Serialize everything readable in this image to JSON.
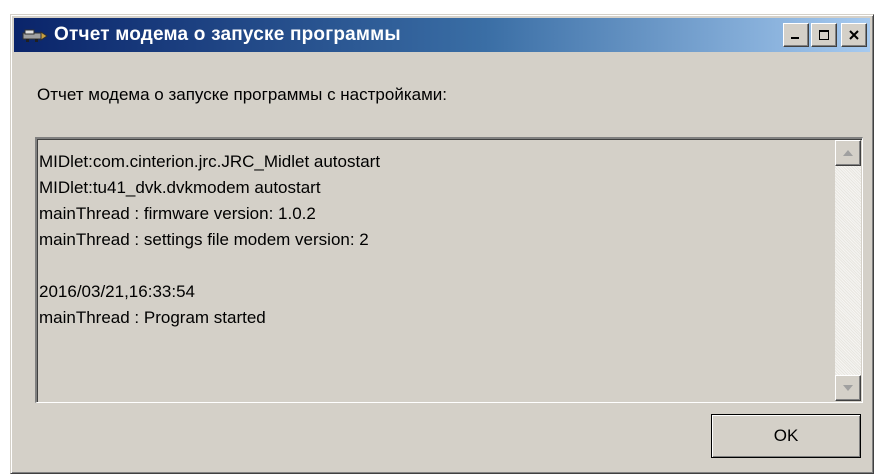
{
  "window": {
    "title": "Отчет модема о запуске программы",
    "icon": "app-icon",
    "buttons": {
      "minimize": "minimize-icon",
      "maximize": "maximize-icon",
      "close": "close-icon"
    }
  },
  "prompt": "Отчет модема о запуске программы с настройками:",
  "report": {
    "lines": [
      "MIDlet:com.cinterion.jrc.JRC_Midlet autostart",
      "MIDlet:tu41_dvk.dvkmodem autostart",
      "mainThread : firmware version: 1.0.2",
      "mainThread : settings file modem version: 2",
      "",
      "2016/03/21,16:33:54",
      "mainThread : Program started"
    ]
  },
  "ok_label": "OK",
  "colors": {
    "title_start": "#0a246a",
    "title_end": "#a6caf0",
    "face": "#d4d0c8"
  }
}
